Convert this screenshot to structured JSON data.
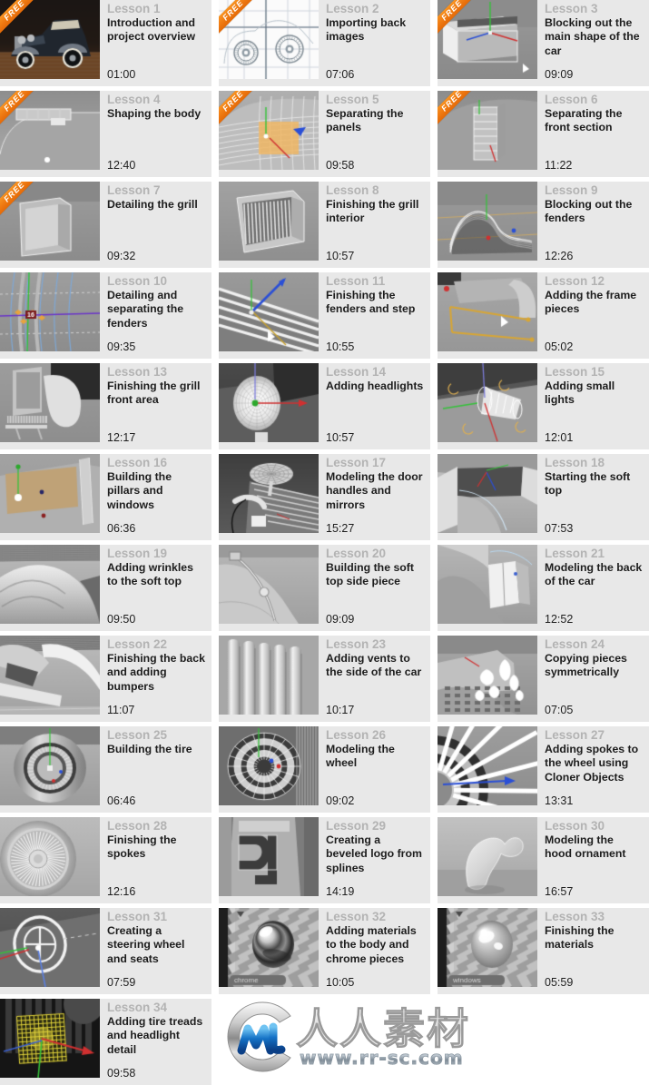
{
  "badge": {
    "free_label": "FREE"
  },
  "watermark": {
    "brand_cn": "人人素材",
    "url": "www.rr-sc.com",
    "logo_letters": "MC"
  },
  "lessons": [
    {
      "number": "Lesson 1",
      "title": "Introduction and project overview",
      "duration": "01:00",
      "free": true,
      "thumb": "car-render-dark"
    },
    {
      "number": "Lesson 2",
      "title": "Importing back images",
      "duration": "07:06",
      "free": true,
      "thumb": "blueprint-white"
    },
    {
      "number": "Lesson 3",
      "title": "Blocking out the main shape of the car",
      "duration": "09:09",
      "free": true,
      "thumb": "viewport-box"
    },
    {
      "number": "Lesson 4",
      "title": "Shaping the body",
      "duration": "12:40",
      "free": true,
      "thumb": "viewport-body"
    },
    {
      "number": "Lesson 5",
      "title": "Separating the panels",
      "duration": "09:58",
      "free": true,
      "thumb": "viewport-panel-orange"
    },
    {
      "number": "Lesson 6",
      "title": "Separating the front section",
      "duration": "11:22",
      "free": true,
      "thumb": "viewport-front"
    },
    {
      "number": "Lesson 7",
      "title": "Detailing the grill",
      "duration": "09:32",
      "free": true,
      "thumb": "viewport-grill"
    },
    {
      "number": "Lesson 8",
      "title": "Finishing the grill interior",
      "duration": "10:57",
      "free": false,
      "thumb": "viewport-grill-slats"
    },
    {
      "number": "Lesson 9",
      "title": "Blocking out the fenders",
      "duration": "12:26",
      "free": false,
      "thumb": "viewport-fender-arc"
    },
    {
      "number": "Lesson 10",
      "title": "Detailing and separating the fenders",
      "duration": "09:35",
      "free": false,
      "thumb": "viewport-fender-edit"
    },
    {
      "number": "Lesson 11",
      "title": "Finishing the fenders and step",
      "duration": "10:55",
      "free": false,
      "thumb": "viewport-step"
    },
    {
      "number": "Lesson 12",
      "title": "Adding the frame pieces",
      "duration": "05:02",
      "free": false,
      "thumb": "viewport-frame"
    },
    {
      "number": "Lesson 13",
      "title": "Finishing the grill front area",
      "duration": "12:17",
      "free": false,
      "thumb": "viewport-grill-front"
    },
    {
      "number": "Lesson 14",
      "title": "Adding headlights",
      "duration": "10:57",
      "free": false,
      "thumb": "viewport-headlight"
    },
    {
      "number": "Lesson 15",
      "title": "Adding small lights",
      "duration": "12:01",
      "free": false,
      "thumb": "viewport-smalllight"
    },
    {
      "number": "Lesson 16",
      "title": "Building the pillars and windows",
      "duration": "06:36",
      "free": false,
      "thumb": "viewport-pillars"
    },
    {
      "number": "Lesson 17",
      "title": "Modeling the door handles and mirrors",
      "duration": "15:27",
      "free": false,
      "thumb": "viewport-mirror"
    },
    {
      "number": "Lesson 18",
      "title": "Starting the soft top",
      "duration": "07:53",
      "free": false,
      "thumb": "viewport-softtop"
    },
    {
      "number": "Lesson 19",
      "title": "Adding wrinkles to the soft top",
      "duration": "09:50",
      "free": false,
      "thumb": "viewport-wrinkles"
    },
    {
      "number": "Lesson 20",
      "title": "Building the soft top side piece",
      "duration": "09:09",
      "free": false,
      "thumb": "viewport-side-piece"
    },
    {
      "number": "Lesson 21",
      "title": "Modeling the back of the car",
      "duration": "12:52",
      "free": false,
      "thumb": "viewport-back"
    },
    {
      "number": "Lesson 22",
      "title": "Finishing the back and adding bumpers",
      "duration": "11:07",
      "free": false,
      "thumb": "viewport-bumpers"
    },
    {
      "number": "Lesson 23",
      "title": "Adding vents to the side of the car",
      "duration": "10:17",
      "free": false,
      "thumb": "viewport-vents"
    },
    {
      "number": "Lesson 24",
      "title": "Copying pieces symmetrically",
      "duration": "07:05",
      "free": false,
      "thumb": "viewport-symmetry"
    },
    {
      "number": "Lesson 25",
      "title": "Building the tire",
      "duration": "06:46",
      "free": false,
      "thumb": "viewport-tire"
    },
    {
      "number": "Lesson 26",
      "title": "Modeling the wheel",
      "duration": "09:02",
      "free": false,
      "thumb": "viewport-wheel"
    },
    {
      "number": "Lesson 27",
      "title": "Adding spokes to the wheel using Cloner Objects",
      "duration": "13:31",
      "free": false,
      "thumb": "viewport-spokes-cloner"
    },
    {
      "number": "Lesson 28",
      "title": "Finishing the spokes",
      "duration": "12:16",
      "free": false,
      "thumb": "viewport-spokes-done"
    },
    {
      "number": "Lesson 29",
      "title": "Creating a beveled logo from splines",
      "duration": "14:19",
      "free": false,
      "thumb": "viewport-logo"
    },
    {
      "number": "Lesson 30",
      "title": "Modeling the hood ornament",
      "duration": "16:57",
      "free": false,
      "thumb": "viewport-ornament"
    },
    {
      "number": "Lesson 31",
      "title": "Creating a steering wheel and seats",
      "duration": "07:59",
      "free": false,
      "thumb": "viewport-steering"
    },
    {
      "number": "Lesson 32",
      "title": "Adding materials to the body and chrome pieces",
      "duration": "10:05",
      "free": false,
      "thumb": "material-chrome",
      "swatch_label": "chrome"
    },
    {
      "number": "Lesson 33",
      "title": "Finishing the materials",
      "duration": "05:59",
      "free": false,
      "thumb": "material-windows",
      "swatch_label": "windows"
    },
    {
      "number": "Lesson 34",
      "title": "Adding tire treads and headlight detail",
      "duration": "09:58",
      "free": false,
      "thumb": "viewport-treads"
    }
  ],
  "colors": {
    "card_bg": "#e8e8e8",
    "page_bg": "#ffffff",
    "lesson_number": "#b3b3b3",
    "lesson_title": "#1d1d1d",
    "badge_orange": "#ef7a12"
  }
}
